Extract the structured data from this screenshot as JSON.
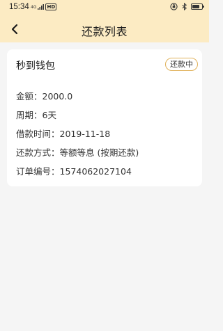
{
  "status_bar": {
    "time": "15:34",
    "signal_text": "4G",
    "hd_badge": "HD",
    "battery_level": 0.8
  },
  "nav": {
    "back_icon": "chevron-left-icon",
    "title": "还款列表"
  },
  "colors": {
    "header_bg": "#fcebc3",
    "page_bg": "#f5f5f5",
    "tag_border": "#e0b15a"
  },
  "loan": {
    "product_name": "秒到钱包",
    "status": "还款中",
    "rows": [
      {
        "label": "金额：",
        "value": "2000.0"
      },
      {
        "label": "周期：",
        "value": "6天"
      },
      {
        "label": "借款时间：",
        "value": "2019-11-18"
      },
      {
        "label": "还款方式：",
        "value": "等额等息 (按期还款)"
      },
      {
        "label": "订单编号：",
        "value": "1574062027104"
      }
    ]
  }
}
